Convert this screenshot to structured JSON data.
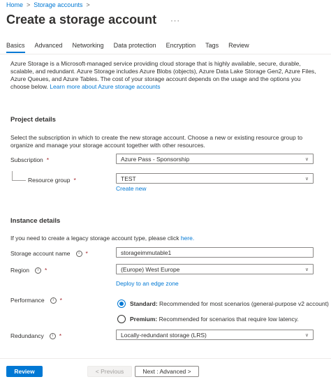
{
  "breadcrumb": {
    "items": [
      "Home",
      "Storage accounts"
    ],
    "separator": ">"
  },
  "page": {
    "title": "Create a storage account",
    "more": "···"
  },
  "tabs": [
    "Basics",
    "Advanced",
    "Networking",
    "Data protection",
    "Encryption",
    "Tags",
    "Review"
  ],
  "active_tab": "Basics",
  "intro": {
    "text": "Azure Storage is a Microsoft-managed service providing cloud storage that is highly available, secure, durable, scalable, and redundant. Azure Storage includes Azure Blobs (objects), Azure Data Lake Storage Gen2, Azure Files, Azure Queues, and Azure Tables. The cost of your storage account depends on the usage and the options you choose below. ",
    "link": "Learn more about Azure storage accounts"
  },
  "project": {
    "title": "Project details",
    "desc": "Select the subscription in which to create the new storage account. Choose a new or existing resource group to organize and manage your storage account together with other resources.",
    "subscription_label": "Subscription",
    "subscription_value": "Azure Pass - Sponsorship",
    "resource_group_label": "Resource group",
    "resource_group_value": "TEST",
    "create_new": "Create new"
  },
  "instance": {
    "title": "Instance details",
    "legacy_text": "If you need to create a legacy storage account type, please click ",
    "legacy_link": "here.",
    "name_label": "Storage account name",
    "name_value": "storageimmutable1",
    "region_label": "Region",
    "region_value": "(Europe) West Europe",
    "edge_zone_link": "Deploy to an edge zone",
    "performance_label": "Performance",
    "performance_options": [
      {
        "name": "Standard:",
        "desc": "Recommended for most scenarios (general-purpose v2 account)",
        "selected": true
      },
      {
        "name": "Premium:",
        "desc": "Recommended for scenarios that require low latency.",
        "selected": false
      }
    ],
    "redundancy_label": "Redundancy",
    "redundancy_value": "Locally-redundant storage (LRS)"
  },
  "footer": {
    "review": "Review",
    "previous": "< Previous",
    "next": "Next : Advanced >"
  },
  "icons": {
    "info": "info-icon",
    "dropdown": "chevron-down-icon",
    "required": "*"
  },
  "colors": {
    "accent": "#0078d4",
    "required": "#a4262c",
    "text": "#323130"
  }
}
